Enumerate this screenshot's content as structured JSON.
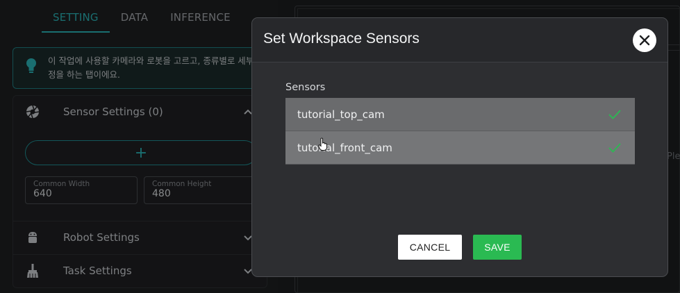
{
  "tabs": [
    {
      "label": "SETTING",
      "active": true
    },
    {
      "label": "DATA",
      "active": false
    },
    {
      "label": "INFERENCE",
      "active": false
    }
  ],
  "info": {
    "line1": "이 작업에 사용할 카메라와 로봇을 고르고, 종류별로 세부 설",
    "line2": "정을 하는 탭이에요."
  },
  "sections": {
    "sensor": {
      "label": "Sensor Settings (0)",
      "icon": "aperture-icon"
    },
    "robot": {
      "label": "Robot Settings",
      "icon": "android-icon"
    },
    "task": {
      "label": "Task Settings",
      "icon": "broom-icon"
    }
  },
  "add_button": {
    "label": "+"
  },
  "common_width": {
    "label": "Common Width",
    "value": "640"
  },
  "common_height": {
    "label": "Common Height",
    "value": "480"
  },
  "right_panel": {
    "side_text": "Plea"
  },
  "modal": {
    "title": "Set Workspace Sensors",
    "sensors_label": "Sensors",
    "sensors": [
      {
        "name": "tutorial_top_cam",
        "selected": true
      },
      {
        "name": "tutorial_front_cam",
        "selected": true
      }
    ],
    "cancel_label": "CANCEL",
    "save_label": "SAVE"
  },
  "colors": {
    "accent": "#2bb3b7",
    "save": "#2aba52",
    "check": "#2aba52"
  }
}
